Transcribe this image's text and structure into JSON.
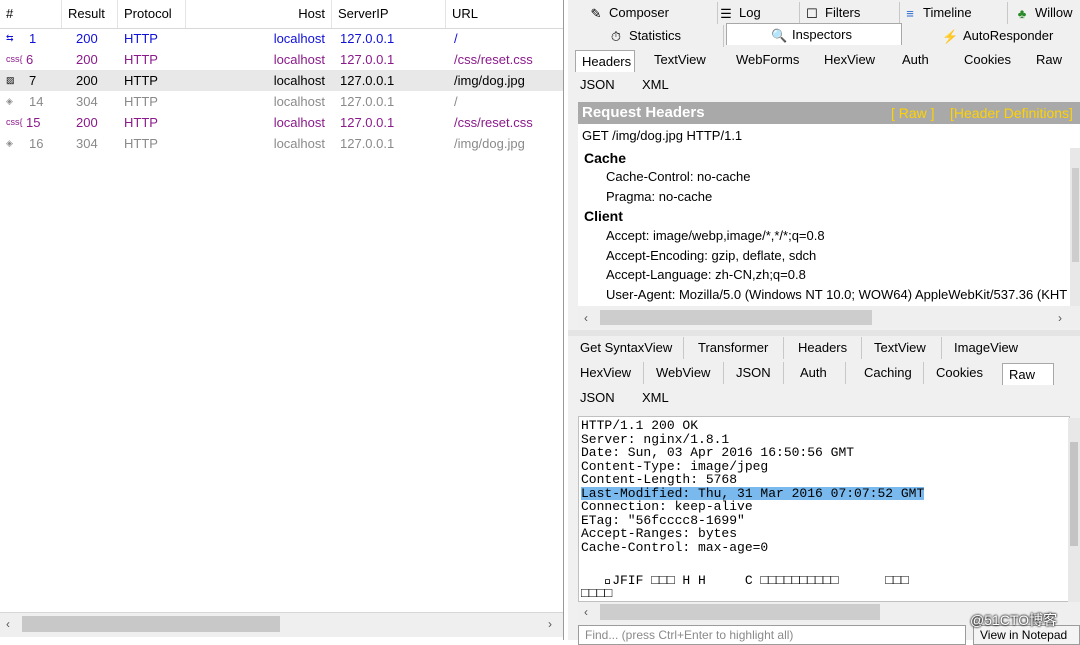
{
  "session_list": {
    "columns": [
      "#",
      "Result",
      "Protocol",
      "Host",
      "ServerIP",
      "URL"
    ],
    "rows": [
      {
        "id": "1",
        "prefix": "",
        "result": "200",
        "protocol": "HTTP",
        "host": "localhost",
        "ip": "127.0.0.1",
        "url": "/",
        "icon": "arrows-icon",
        "color": "#1010d8"
      },
      {
        "id": "6",
        "prefix": "css{",
        "result": "200",
        "protocol": "HTTP",
        "host": "localhost",
        "ip": "127.0.0.1",
        "url": "/css/reset.css",
        "icon": "css-icon",
        "color": "#8a1a8a"
      },
      {
        "id": "7",
        "prefix": "",
        "result": "200",
        "protocol": "HTTP",
        "host": "localhost",
        "ip": "127.0.0.1",
        "url": "/img/dog.jpg",
        "icon": "image-icon",
        "color": "#000000"
      },
      {
        "id": "14",
        "prefix": "",
        "result": "304",
        "protocol": "HTTP",
        "host": "localhost",
        "ip": "127.0.0.1",
        "url": "/",
        "icon": "not-modified-icon",
        "color": "#8a8a8a"
      },
      {
        "id": "15",
        "prefix": "css{",
        "result": "200",
        "protocol": "HTTP",
        "host": "localhost",
        "ip": "127.0.0.1",
        "url": "/css/reset.css",
        "icon": "css-icon",
        "color": "#8a1a8a"
      },
      {
        "id": "16",
        "prefix": "",
        "result": "304",
        "protocol": "HTTP",
        "host": "localhost",
        "ip": "127.0.0.1",
        "url": "/img/dog.jpg",
        "icon": "not-modified-icon",
        "color": "#8a8a8a"
      }
    ]
  },
  "top_tabs": {
    "row1": [
      "Composer",
      "Log",
      "Filters",
      "Timeline",
      "Willow"
    ],
    "row2": [
      "Statistics",
      "Inspectors",
      "AutoResponder"
    ]
  },
  "request_tabs": {
    "row1": [
      "Headers",
      "TextView",
      "WebForms",
      "HexView",
      "Auth",
      "Cookies",
      "Raw"
    ],
    "row2": [
      "JSON",
      "XML"
    ]
  },
  "request_headers": {
    "title": "Request Headers",
    "raw_link": "[ Raw ]",
    "defs_link": "[Header Definitions]",
    "request_line": "GET /img/dog.jpg HTTP/1.1",
    "groups": [
      {
        "name": "Cache",
        "items": [
          "Cache-Control: no-cache",
          "Pragma: no-cache"
        ]
      },
      {
        "name": "Client",
        "items": [
          "Accept: image/webp,image/*,*/*;q=0.8",
          "Accept-Encoding: gzip, deflate, sdch",
          "Accept-Language: zh-CN,zh;q=0.8",
          "User-Agent: Mozilla/5.0 (Windows NT 10.0; WOW64) AppleWebKit/537.36 (KHT"
        ]
      }
    ]
  },
  "response_tabs": {
    "row1": [
      "Get SyntaxView",
      "Transformer",
      "Headers",
      "TextView",
      "ImageView"
    ],
    "row2": [
      "HexView",
      "WebView",
      "JSON",
      "Auth",
      "Caching",
      "Cookies",
      "Raw"
    ],
    "row3": [
      "JSON",
      "XML"
    ]
  },
  "response_raw": {
    "lines": [
      "HTTP/1.1 200 OK",
      "Server: nginx/1.8.1",
      "Date: Sun, 03 Apr 2016 16:50:56 GMT",
      "Content-Type: image/jpeg",
      "Content-Length: 5768",
      "Last-Modified: Thu, 31 Mar 2016 07:07:52 GMT",
      "Connection: keep-alive",
      "ETag: \"56fcccc8-1699\"",
      "Accept-Ranges: bytes",
      "Cache-Control: max-age=0",
      "",
      "   \u0000JFIF □□□ H H     C □□□□□□□□□□      □□□",
      "□□□□"
    ],
    "highlighted_line": "Last-Modified: Thu, 31 Mar 2016 07:07:52 GMT"
  },
  "find": {
    "placeholder": "Find... (press Ctrl+Enter to highlight all)"
  },
  "view_notepad": "View in Notepad",
  "watermark": "@51CTO博客"
}
